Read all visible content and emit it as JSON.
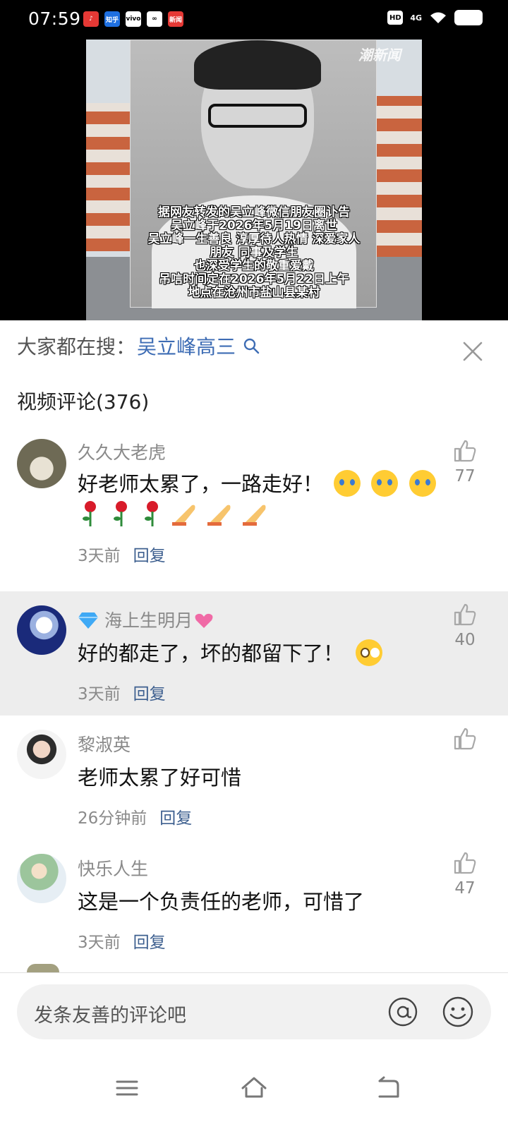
{
  "status_bar": {
    "time": "07:59",
    "apps": [
      "♪",
      "知乎",
      "vivo",
      "∞",
      "新闻"
    ],
    "hd": "HD",
    "network": "4G"
  },
  "video": {
    "watermark": "潮新闻",
    "caption_lines": [
      "据网友转发的吴立峰微信朋友圈讣告",
      "吴立峰于2026年5月19日离世",
      "吴立峰一生善良 淳厚待人热情 深爱家人",
      "朋友 同事及学生",
      "也深受学生的敬重爱戴",
      "吊唁时间定在2026年5月22日上午",
      "地点在沧州市盐山县某村"
    ]
  },
  "search": {
    "prefix": "大家都在搜：",
    "term": "吴立峰高三"
  },
  "comments_header": "视频评论(376)",
  "comments": [
    {
      "username": "久久大老虎",
      "text": "好老师太累了，一路走好！",
      "time": "3天前",
      "reply": "回复",
      "likes": "77"
    },
    {
      "username": "海上生明月",
      "text": "好的都走了，坏的都留下了！",
      "time": "3天前",
      "reply": "回复",
      "likes": "40"
    },
    {
      "username": "黎淑英",
      "text": "老师太累了好可惜",
      "time": "26分钟前",
      "reply": "回复",
      "likes": ""
    },
    {
      "username": "快乐人生",
      "text": "这是一个负责任的老师，可惜了",
      "time": "3天前",
      "reply": "回复",
      "likes": "47"
    }
  ],
  "input": {
    "placeholder": "发条友善的评论吧"
  },
  "icons": {
    "search": "search-icon",
    "close": "close-icon",
    "like": "thumbs-up-icon",
    "at": "at-icon",
    "emoji": "smiley-icon",
    "nav": [
      "menu-icon",
      "home-icon",
      "back-icon"
    ]
  },
  "colors": {
    "link_blue": "#3d6cb4",
    "reply_blue": "#3d5f8f",
    "highlight_row": "#ededed"
  }
}
